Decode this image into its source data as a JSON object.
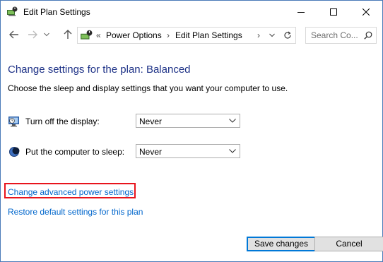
{
  "window": {
    "title": "Edit Plan Settings",
    "icon": "power-options-icon"
  },
  "caption_buttons": {
    "minimize": "minimize-icon",
    "maximize": "maximize-icon",
    "close": "close-icon"
  },
  "navigation": {
    "back": "back-arrow-icon",
    "forward": "forward-arrow-icon",
    "recent": "chevron-down-icon",
    "up": "up-arrow-icon"
  },
  "address_bar": {
    "overflow": "«",
    "crumbs": [
      "Power Options",
      "Edit Plan Settings"
    ],
    "separator": "›"
  },
  "search": {
    "placeholder": "Search Co..."
  },
  "main": {
    "heading": "Change settings for the plan: Balanced",
    "subtitle": "Choose the sleep and display settings that you want your computer to use.",
    "settings": [
      {
        "label": "Turn off the display:",
        "value": "Never",
        "icon": "display-icon"
      },
      {
        "label": "Put the computer to sleep:",
        "value": "Never",
        "icon": "sleep-moon-icon"
      }
    ],
    "links": {
      "advanced": "Change advanced power settings",
      "restore": "Restore default settings for this plan"
    }
  },
  "footer": {
    "save": "Save changes",
    "cancel": "Cancel"
  },
  "colors": {
    "heading": "#1e3287",
    "link": "#0066cc",
    "highlight_box": "#e8141c",
    "default_button_border": "#0078d7"
  }
}
